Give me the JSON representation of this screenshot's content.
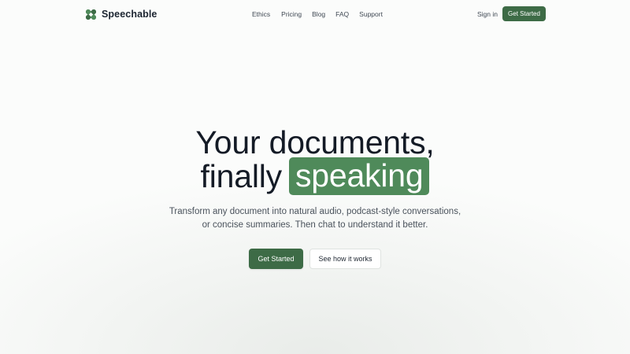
{
  "brand": {
    "name": "Speechable",
    "logo_icon": "speechable-logo-icon",
    "accent_color": "#3d6b46",
    "highlight_color": "#4f8a5a"
  },
  "nav": {
    "links": [
      "Ethics",
      "Pricing",
      "Blog",
      "FAQ",
      "Support"
    ],
    "sign_in_label": "Sign in",
    "cta_label": "Get Started"
  },
  "hero": {
    "line1": "Your documents,",
    "line2_plain": "finally",
    "line2_highlight": "speaking",
    "subtext_line1": "Transform any document into natural audio, podcast-style conversations,",
    "subtext_line2": "or concise summaries. Then chat to understand it better.",
    "primary_cta": "Get Started",
    "secondary_cta": "See how it works"
  }
}
